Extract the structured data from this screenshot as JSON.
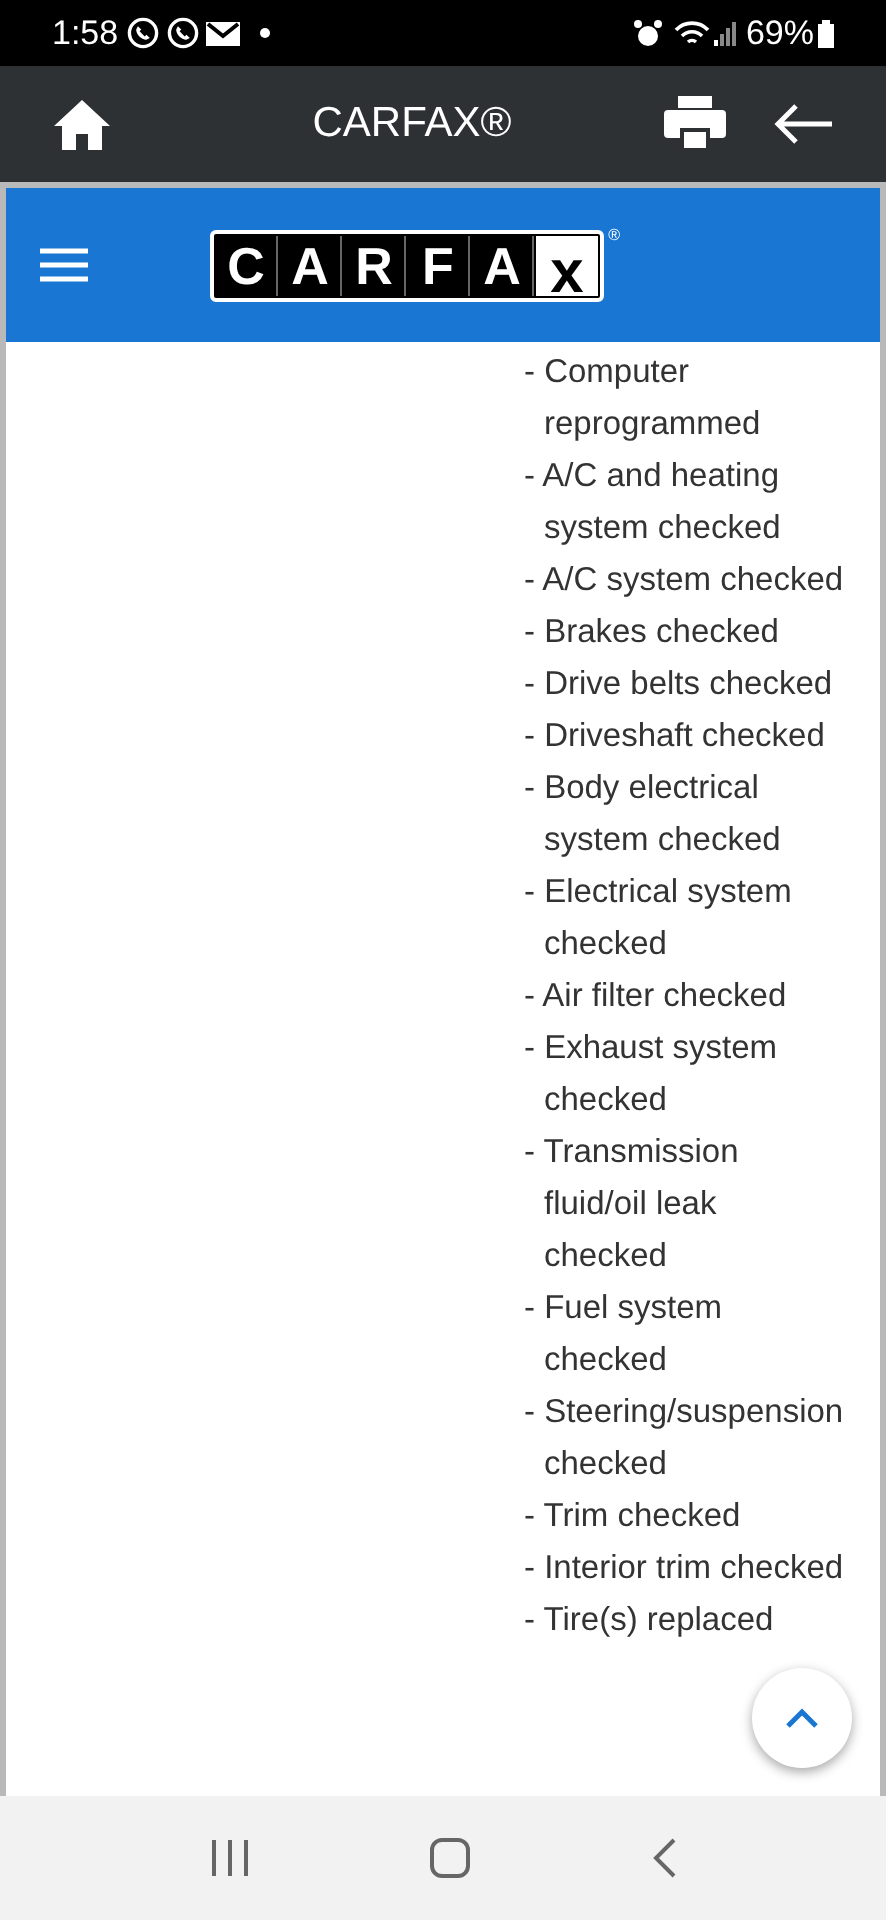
{
  "status_bar": {
    "time": "1:58",
    "battery": "69%"
  },
  "app_bar": {
    "title": "CARFAX®"
  },
  "site_header": {
    "logo_letters": [
      "C",
      "A",
      "R",
      "F",
      "A",
      "x"
    ],
    "logo_mark": "®"
  },
  "service_items": [
    "- Computer reprogrammed",
    "- A/C and heating system checked",
    "- A/C system checked",
    "- Brakes checked",
    "- Drive belts checked",
    "- Driveshaft checked",
    "- Body electrical system checked",
    "- Electrical system checked",
    "- Air filter checked",
    "- Exhaust system checked",
    "- Transmission fluid/oil leak checked",
    "- Fuel system checked",
    "- Steering/suspension checked",
    "- Trim checked",
    "- Interior trim checked",
    "- Tire(s) replaced"
  ]
}
